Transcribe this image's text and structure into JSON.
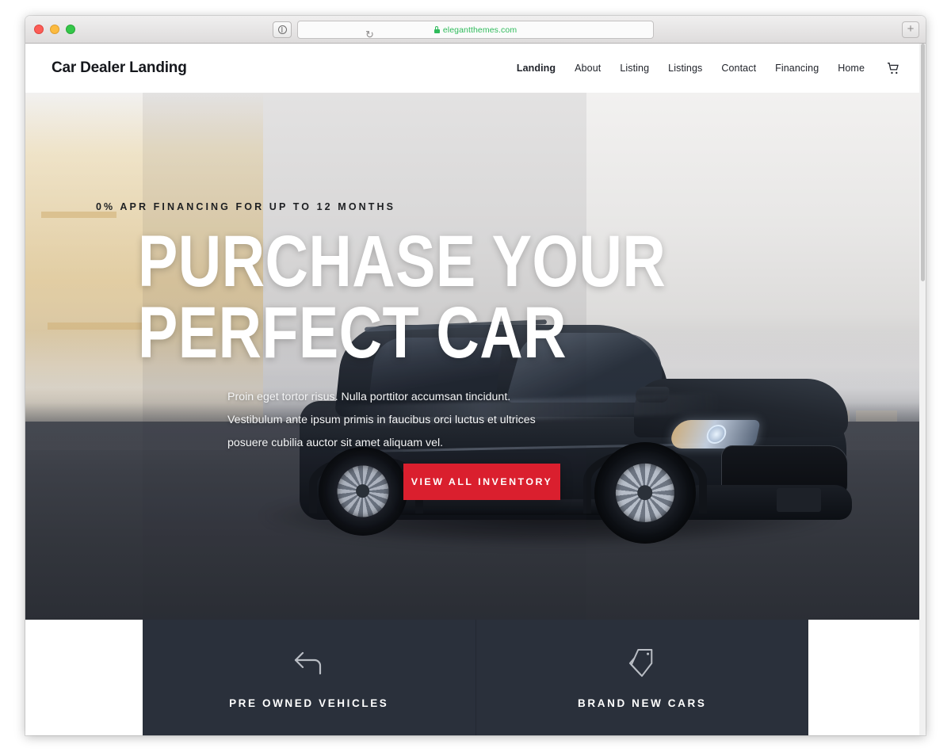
{
  "browser": {
    "url": "elegantthemes.com",
    "lock_icon": "lock-icon",
    "shield_icon": "shield-icon",
    "reader_icon": "reader-view-icon",
    "reload_icon": "reload-icon",
    "reload_glyph": "↻",
    "newtab_label": "+",
    "traffic_lights": [
      "close",
      "minimize",
      "zoom"
    ]
  },
  "site": {
    "brand": "Car Dealer Landing",
    "nav": [
      {
        "label": "Landing",
        "active": true
      },
      {
        "label": "About",
        "active": false
      },
      {
        "label": "Listing",
        "active": false
      },
      {
        "label": "Listings",
        "active": false
      },
      {
        "label": "Contact",
        "active": false
      },
      {
        "label": "Financing",
        "active": false
      },
      {
        "label": "Home",
        "active": false
      }
    ],
    "cart_icon": "shopping-cart-icon"
  },
  "hero": {
    "eyebrow": "0% APR FINANCING FOR UP TO 12 MONTHS",
    "headline_line1": "PURCHASE YOUR",
    "headline_line2": "PERFECT CAR",
    "paragraph": "Proin eget tortor risus. Nulla porttitor accumsan tincidunt. Vestibulum ante ipsum primis in faucibus orci luctus et ultrices posuere cubilia auctor sit amet aliquam vel.",
    "cta_label": "VIEW ALL INVENTORY",
    "cta_color": "#da1f2e",
    "image_subject": "black-suv-on-asphalt"
  },
  "features": [
    {
      "label": "PRE OWNED VEHICLES",
      "icon": "return-arrow-icon"
    },
    {
      "label": "BRAND NEW CARS",
      "icon": "price-tag-icon"
    }
  ],
  "colors": {
    "accent_red": "#da1f2e",
    "card_dark": "#2a303b",
    "text_dark": "#21242b",
    "url_green": "#2fbb5b"
  }
}
